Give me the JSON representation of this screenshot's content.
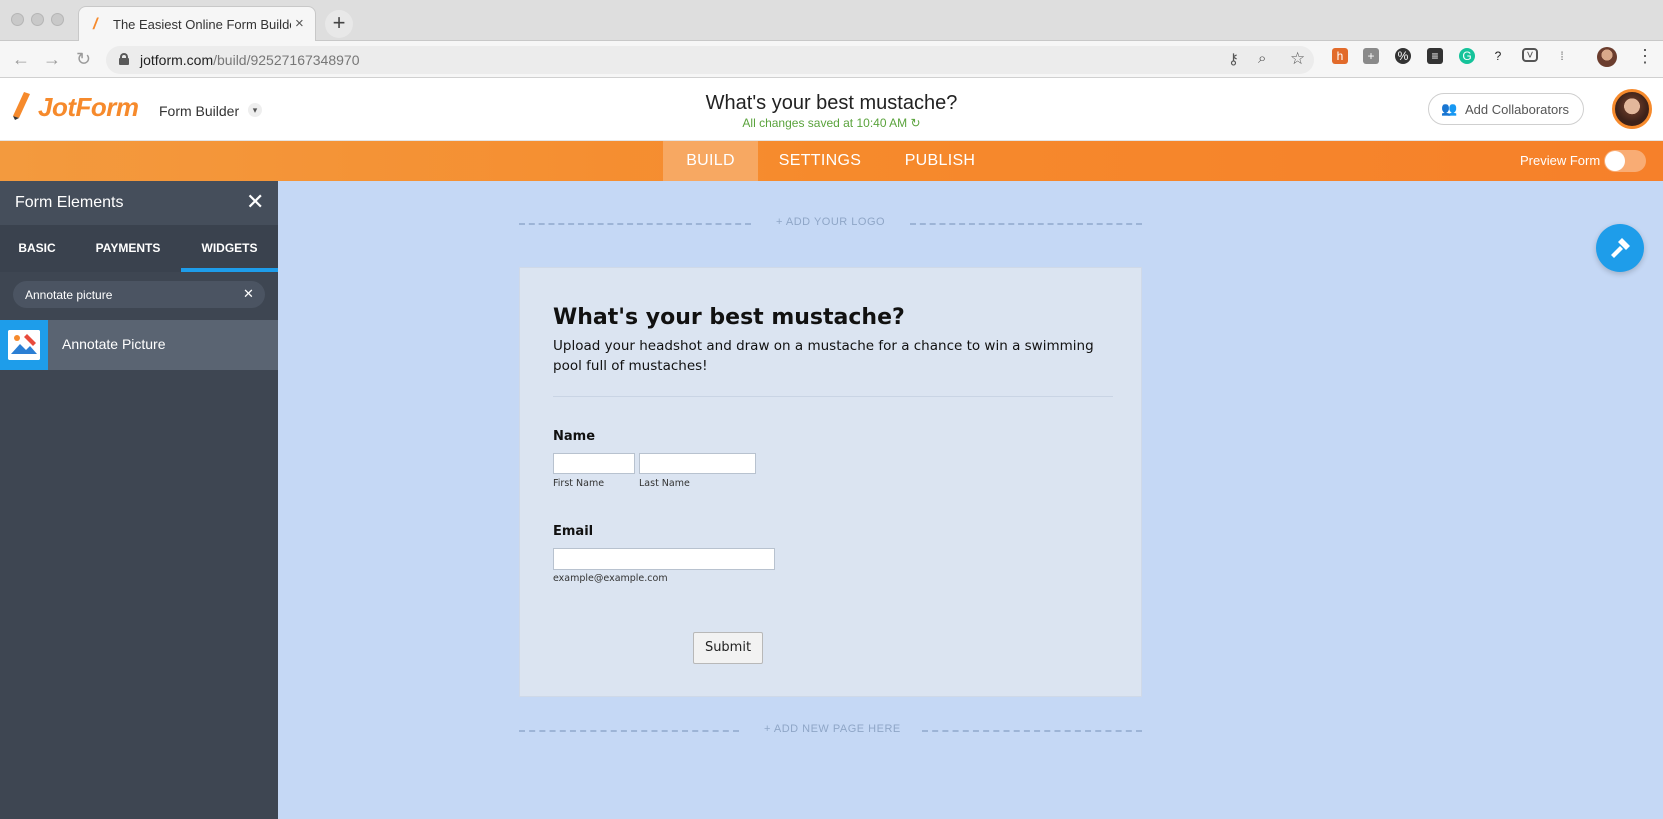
{
  "browser": {
    "tab_title": "The Easiest Online Form Builder",
    "tab_close": "×",
    "new_tab": "+",
    "url_host": "jotform.com",
    "url_path": "/build/92527167348970"
  },
  "header": {
    "logo": "JotForm",
    "builder_label": "Form Builder",
    "form_title": "What's your best mustache?",
    "save_status": "All changes saved at 10:40 AM ↻",
    "add_collaborators": "Add Collaborators"
  },
  "nav": {
    "tabs": [
      "BUILD",
      "SETTINGS",
      "PUBLISH"
    ],
    "active_tab": "BUILD",
    "preview_label": "Preview Form",
    "preview_on": false
  },
  "sidebar": {
    "title": "Form Elements",
    "tabs": [
      "BASIC",
      "PAYMENTS",
      "WIDGETS"
    ],
    "active_tab": "WIDGETS",
    "search_value": "Annotate picture",
    "results": [
      {
        "label": "Annotate Picture",
        "icon": "annotate-picture-icon"
      }
    ]
  },
  "canvas": {
    "add_logo": "+ ADD YOUR LOGO",
    "add_page": "+ ADD NEW PAGE HERE"
  },
  "form": {
    "title": "What's your best mustache?",
    "description": "Upload your headshot and draw on a mustache for a chance to win a swimming pool full of mustaches!",
    "name_label": "Name",
    "first_name_sub": "First Name",
    "last_name_sub": "Last Name",
    "email_label": "Email",
    "email_sub": "example@example.com",
    "submit": "Submit"
  },
  "colors": {
    "brand_orange": "#f68a2c",
    "accent_blue": "#1e9dea",
    "canvas_bg": "#c5d8f5",
    "sidebar_bg": "#3e4652"
  }
}
